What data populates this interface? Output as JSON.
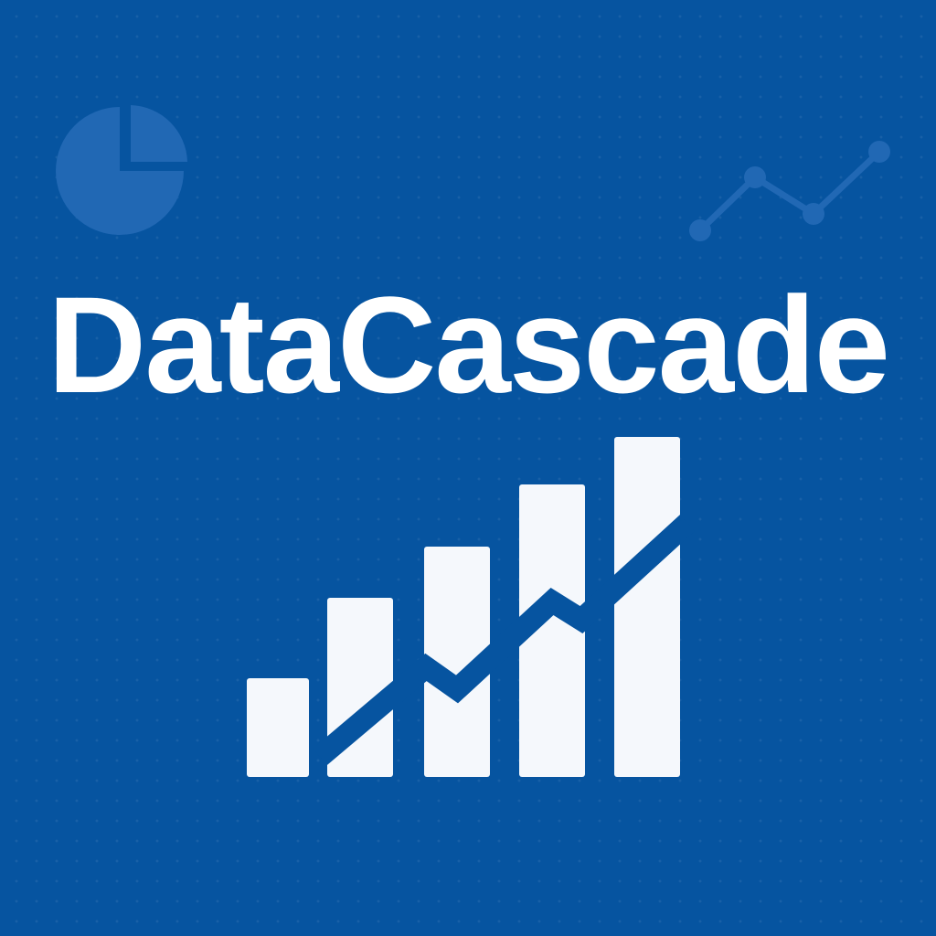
{
  "brand": {
    "name": "DataCascade"
  },
  "colors": {
    "background": "#0654a0",
    "foreground": "#f5f8fc",
    "decoration": "#2168b4"
  },
  "icons": {
    "top_left": "pie-chart-icon",
    "top_right": "line-chart-icon",
    "logo": "rising-bar-chart-with-trend-line-icon"
  }
}
